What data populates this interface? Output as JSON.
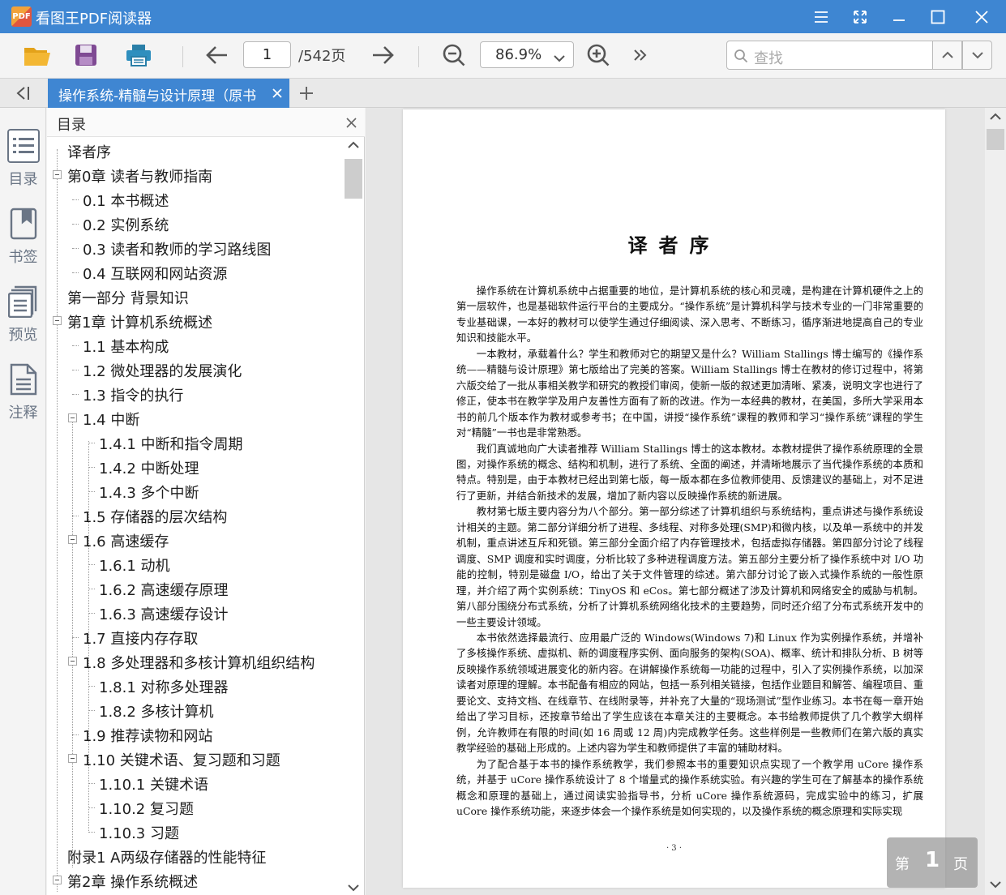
{
  "app": {
    "logo_text": "PDF",
    "title": "看图王PDF阅读器",
    "accent_color": "#3e86d2"
  },
  "window_controls": [
    "menu-icon",
    "fullscreen-icon",
    "minimize-icon",
    "maximize-icon",
    "close-icon"
  ],
  "toolbar": {
    "buttons": [
      "open-folder-icon",
      "save-icon",
      "print-icon",
      "arrow-left-icon",
      "arrow-right-icon",
      "zoom-out-icon",
      "zoom-in-icon",
      "more-icon"
    ],
    "page_current": "1",
    "page_total": "/542页",
    "zoom": "86.9%",
    "search_placeholder": "查找"
  },
  "tabs": {
    "active_label": "操作系统-精髓与设计原理（原书",
    "add_label": "+"
  },
  "rail": {
    "items": [
      {
        "icon": "toc-icon",
        "label": "目录"
      },
      {
        "icon": "bookmark-icon",
        "label": "书签"
      },
      {
        "icon": "preview-icon",
        "label": "预览"
      },
      {
        "icon": "annotation-icon",
        "label": "注释"
      }
    ]
  },
  "toc": {
    "title": "目录",
    "items": [
      {
        "label": "译者序",
        "level": 0,
        "toggle": false
      },
      {
        "label": "第0章 读者与教师指南",
        "level": 0,
        "toggle": true
      },
      {
        "label": "0.1 本书概述",
        "level": 1,
        "toggle": false
      },
      {
        "label": "0.2 实例系统",
        "level": 1,
        "toggle": false
      },
      {
        "label": "0.3 读者和教师的学习路线图",
        "level": 1,
        "toggle": false
      },
      {
        "label": "0.4 互联网和网站资源",
        "level": 1,
        "toggle": false
      },
      {
        "label": "第一部分 背景知识",
        "level": 0,
        "toggle": false
      },
      {
        "label": "第1章 计算机系统概述",
        "level": 0,
        "toggle": true
      },
      {
        "label": "1.1 基本构成",
        "level": 1,
        "toggle": false
      },
      {
        "label": "1.2 微处理器的发展演化",
        "level": 1,
        "toggle": false
      },
      {
        "label": "1.3 指令的执行",
        "level": 1,
        "toggle": false
      },
      {
        "label": "1.4 中断",
        "level": 1,
        "toggle": true
      },
      {
        "label": "1.4.1 中断和指令周期",
        "level": 2,
        "toggle": false
      },
      {
        "label": "1.4.2 中断处理",
        "level": 2,
        "toggle": false
      },
      {
        "label": "1.4.3 多个中断",
        "level": 2,
        "toggle": false
      },
      {
        "label": "1.5 存储器的层次结构",
        "level": 1,
        "toggle": false
      },
      {
        "label": "1.6 高速缓存",
        "level": 1,
        "toggle": true
      },
      {
        "label": "1.6.1 动机",
        "level": 2,
        "toggle": false
      },
      {
        "label": "1.6.2 高速缓存原理",
        "level": 2,
        "toggle": false
      },
      {
        "label": "1.6.3 高速缓存设计",
        "level": 2,
        "toggle": false
      },
      {
        "label": "1.7 直接内存存取",
        "level": 1,
        "toggle": false
      },
      {
        "label": "1.8 多处理器和多核计算机组织结构",
        "level": 1,
        "toggle": true
      },
      {
        "label": "1.8.1 对称多处理器",
        "level": 2,
        "toggle": false
      },
      {
        "label": "1.8.2 多核计算机",
        "level": 2,
        "toggle": false
      },
      {
        "label": "1.9 推荐读物和网站",
        "level": 1,
        "toggle": false
      },
      {
        "label": "1.10 关键术语、复习题和习题",
        "level": 1,
        "toggle": true
      },
      {
        "label": "1.10.1 关键术语",
        "level": 2,
        "toggle": false
      },
      {
        "label": "1.10.2 复习题",
        "level": 2,
        "toggle": false
      },
      {
        "label": "1.10.3 习题",
        "level": 2,
        "toggle": false
      },
      {
        "label": "附录1 A两级存储器的性能特征",
        "level": 0,
        "toggle": false
      },
      {
        "label": "第2章 操作系统概述",
        "level": 0,
        "toggle": true
      }
    ]
  },
  "document": {
    "heading": "译者序",
    "paragraphs": [
      "操作系统在计算机系统中占据重要的地位，是计算机系统的核心和灵魂，是构建在计算机硬件之上的第一层软件，也是基础软件运行平台的主要成分。“操作系统”是计算机科学与技术专业的一门非常重要的专业基础课，一本好的教材可以使学生通过仔细阅读、深入思考、不断练习，循序渐进地提高自己的专业知识和技能水平。",
      "一本教材，承载着什么？学生和教师对它的期望又是什么？William Stallings 博士编写的《操作系统——精髓与设计原理》第七版给出了完美的答案。William Stallings 博士在教材的修订过程中，将第六版交给了一批从事相关教学和研究的教授们审阅，使新一版的叙述更加清晰、紧凑，说明文字也进行了修正，使本书在教学学及用户友善性方面有了新的改进。作为一本经典的教材，在美国，多所大学采用本书的前几个版本作为教材或参考书；在中国，讲授“操作系统”课程的教师和学习“操作系统”课程的学生对“精髓”一书也是非常熟悉。",
      "我们真诚地向广大读者推荐 William Stallings 博士的这本教材。本教材提供了操作系统原理的全景图，对操作系统的概念、结构和机制，进行了系统、全面的阐述，并清晰地展示了当代操作系统的本质和特点。特别是，由于本教材已经出到第七版，每一版本都在多位教师使用、反馈建议的基础上，对不足进行了更新，并结合新技术的发展，增加了新内容以反映操作系统的新进展。",
      "教材第七版主要内容分为八个部分。第一部分综述了计算机组织与系统结构，重点讲述与操作系统设计相关的主题。第二部分详细分析了进程、多线程、对称多处理(SMP)和微内核，以及单一系统中的并发机制，重点讲述互斥和死锁。第三部分全面介绍了内存管理技术，包括虚拟存储器。第四部分讨论了线程调度、SMP 调度和实时调度，分析比较了多种进程调度方法。第五部分主要分析了操作系统中对 I/O 功能的控制，特别是磁盘 I/O，给出了关于文件管理的综述。第六部分讨论了嵌入式操作系统的一般性原理，并介绍了两个实例系统：TinyOS 和 eCos。第七部分概述了涉及计算机和网络安全的威胁与机制。第八部分围绕分布式系统，分析了计算机系统网络化技术的主要趋势，同时还介绍了分布式系统开发中的一些主要设计领域。",
      "本书依然选择最流行、应用最广泛的 Windows(Windows 7)和 Linux 作为实例操作系统，并增补了多核操作系统、虚拟机、新的调度程序实例、面向服务的架构(SOA)、概率、统计和排队分析、B 树等反映操作系统领域进展变化的新内容。在讲解操作系统每一功能的过程中，引入了实例操作系统，以加深读者对原理的理解。本书配备有相应的网站，包括一系列相关链接，包括作业题目和解答、编程项目、重要论文、支持文档、在线章节、在线附录等，并补充了大量的“现场测试”型作业练习。本书在每一章开始给出了学习目标，还按章节给出了学生应该在本章关注的主要概念。本书给教师提供了几个教学大纲样例，允许教师在有限的时间(如 16 周或 12 周)内完成教学任务。这些样例是一些教师们在第六版的真实教学经验的基础上形成的。上述内容为学生和教师提供了丰富的辅助材料。",
      "为了配合基于本书的操作系统教学，我们参照本书的重要知识点实现了一个教学用 uCore 操作系统，并基于 uCore 操作系统设计了 8 个增量式的操作系统实验。有兴趣的学生可在了解基本的操作系统概念和原理的基础上，通过阅读实验指导书，分析 uCore 操作系统源码，完成实验中的练习，扩展 uCore 操作系统功能，来逐步体会一个操作系统是如何实现的，以及操作系统的概念原理和实际实现"
    ],
    "footer": "· 3 ·"
  },
  "page_badge": {
    "prefix": "第",
    "number": "1",
    "suffix": "页"
  }
}
